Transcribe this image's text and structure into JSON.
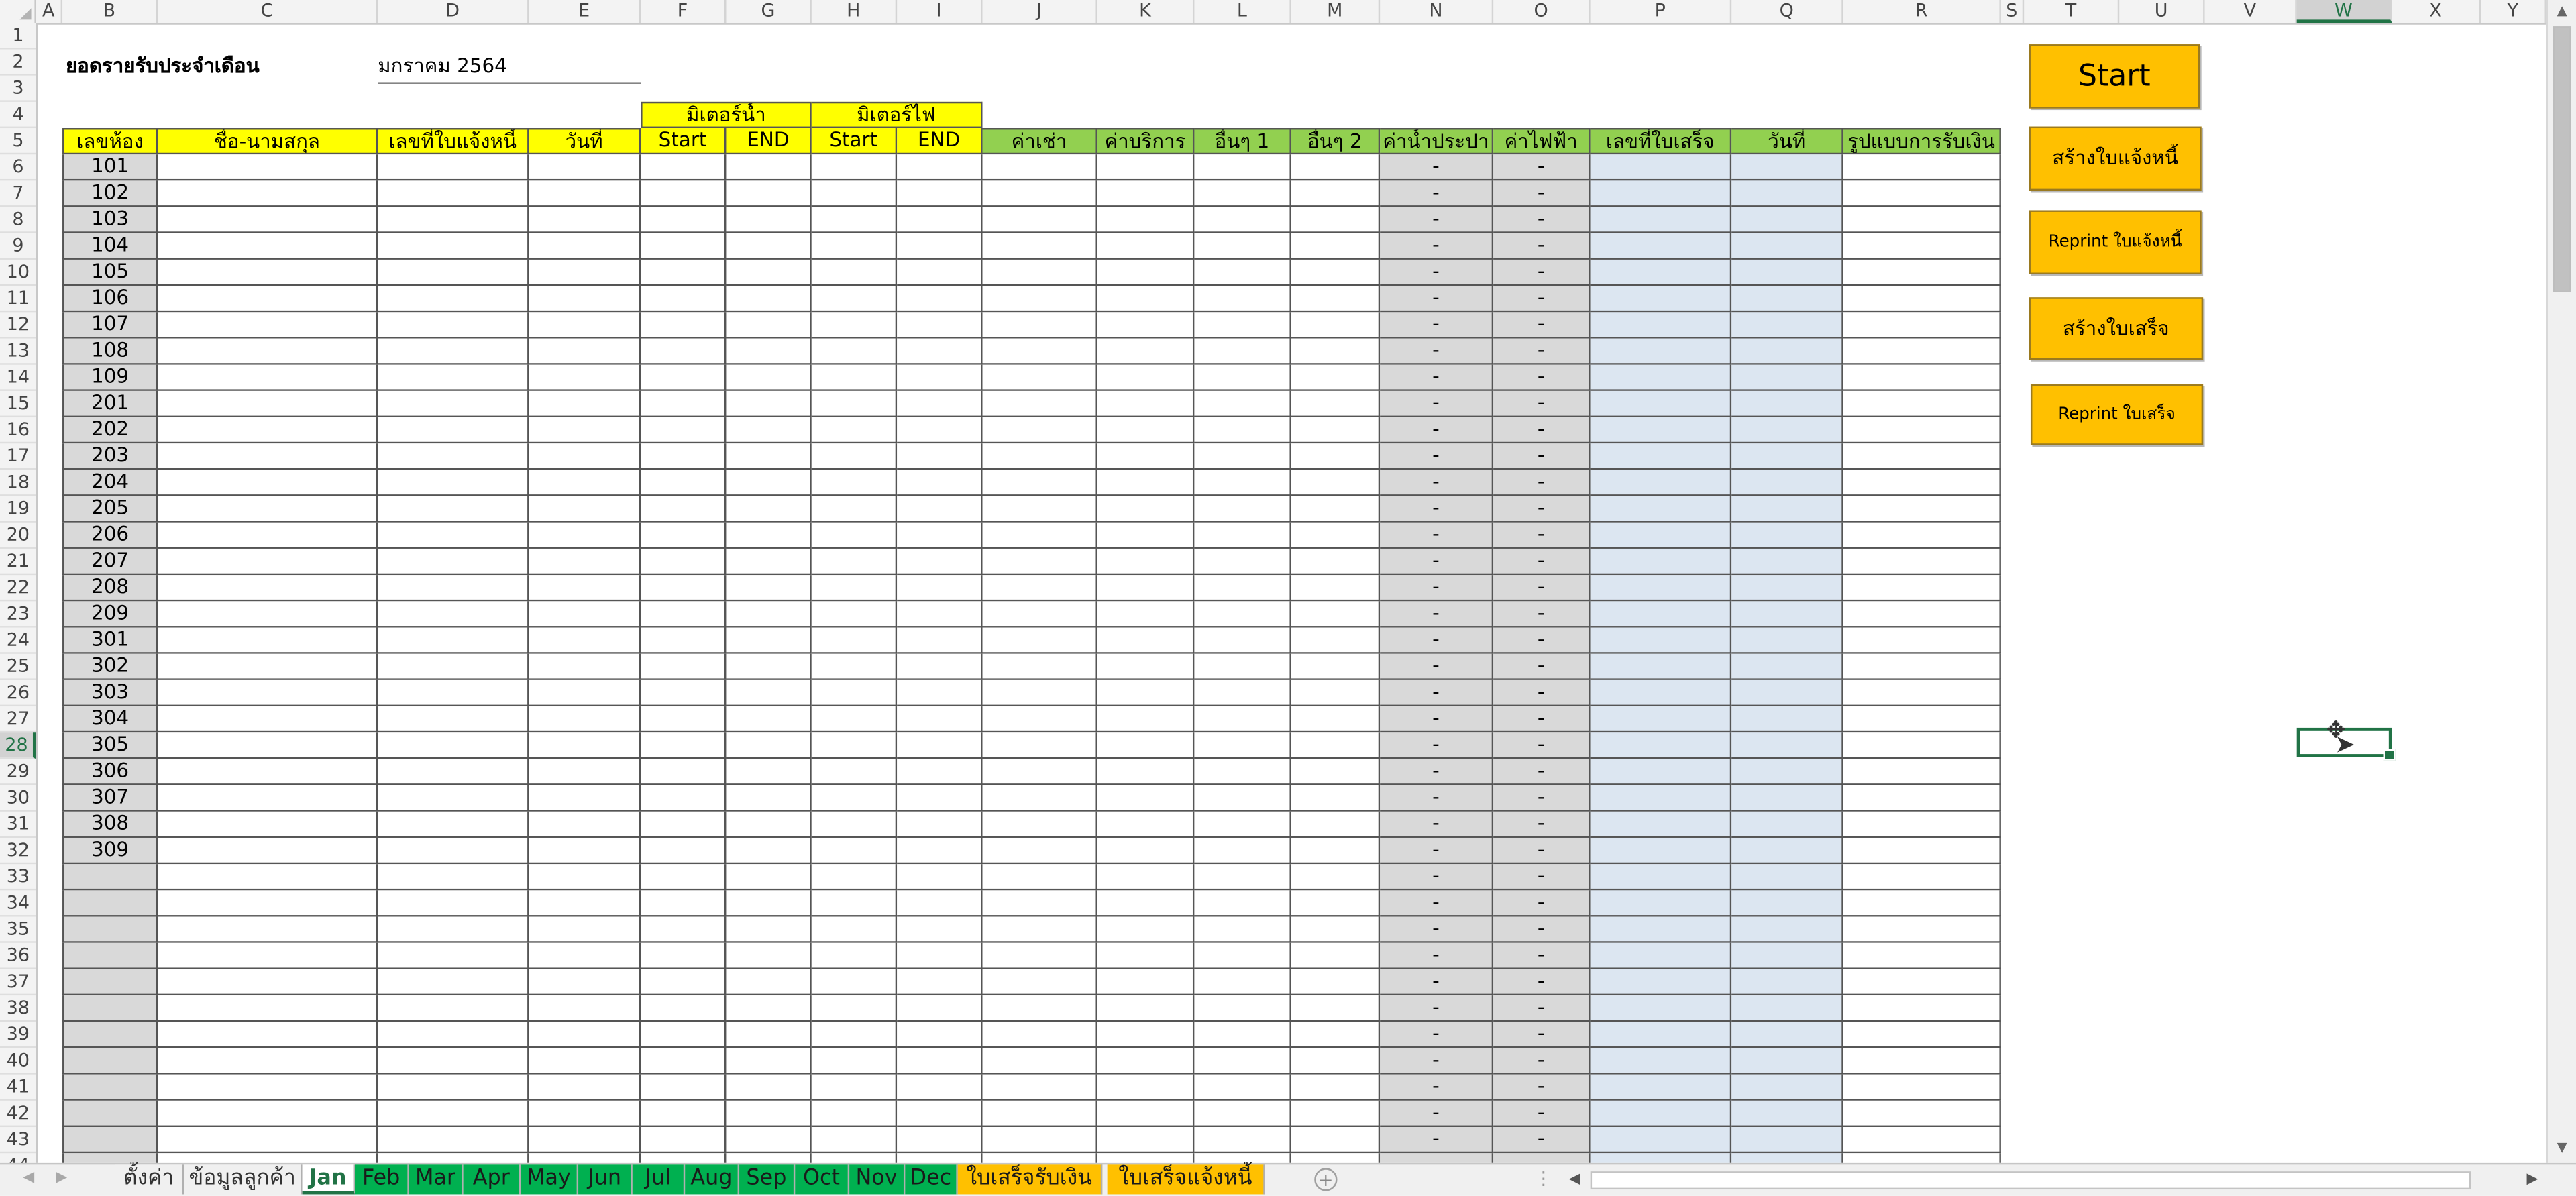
{
  "columns": [
    "A",
    "B",
    "C",
    "D",
    "E",
    "F",
    "G",
    "H",
    "I",
    "J",
    "K",
    "L",
    "M",
    "N",
    "O",
    "P",
    "Q",
    "R",
    "S",
    "T",
    "U",
    "V",
    "W",
    "X",
    "Y"
  ],
  "selected_column": "W",
  "selected_row": 28,
  "title": "ยอดรายรับประจำเดือน",
  "month": "มกราคม 2564",
  "group_headers": {
    "water_meter": "มิเตอร์น้ำ",
    "electric_meter": "มิเตอร์ไฟ"
  },
  "headers": {
    "room": "เลขห้อง",
    "name": "ชื่อ-นามสกุล",
    "invoice_no": "เลขที่ใบแจ้งหนี้",
    "date": "วันที่",
    "water_start": "Start",
    "water_end": "END",
    "elec_start": "Start",
    "elec_end": "END",
    "rent": "ค่าเช่า",
    "service": "ค่าบริการ",
    "other1": "อื่นๆ 1",
    "other2": "อื่นๆ 2",
    "water_fee": "ค่าน้ำประปา",
    "elec_fee": "ค่าไฟฟ้า",
    "receipt_no": "เลขที่ใบเสร็จ",
    "receipt_date": "วันที่",
    "payment_type": "รูปแบบการรับเงิน"
  },
  "rooms": [
    "101",
    "102",
    "103",
    "104",
    "105",
    "106",
    "107",
    "108",
    "109",
    "201",
    "202",
    "203",
    "204",
    "205",
    "206",
    "207",
    "208",
    "209",
    "301",
    "302",
    "303",
    "304",
    "305",
    "306",
    "307",
    "308",
    "309"
  ],
  "dash": "-",
  "buttons": {
    "start": "Start",
    "create_invoice": "สร้างใบแจ้งหนี้",
    "reprint_invoice": "Reprint ใบแจ้งหนี้",
    "create_receipt": "สร้างใบเสร็จ",
    "reprint_receipt": "Reprint ใบเสร็จ"
  },
  "tabs": [
    {
      "label": "ตั้งค่า",
      "style": "grey"
    },
    {
      "label": "ข้อมูลลูกค้า",
      "style": "grey"
    },
    {
      "label": "Jan",
      "style": "active"
    },
    {
      "label": "Feb",
      "style": "green"
    },
    {
      "label": "Mar",
      "style": "green"
    },
    {
      "label": "Apr",
      "style": "green"
    },
    {
      "label": "May",
      "style": "green"
    },
    {
      "label": "Jun",
      "style": "green"
    },
    {
      "label": "Jul",
      "style": "green"
    },
    {
      "label": "Aug",
      "style": "green"
    },
    {
      "label": "Sep",
      "style": "green"
    },
    {
      "label": "Oct",
      "style": "green"
    },
    {
      "label": "Nov",
      "style": "green"
    },
    {
      "label": "Dec",
      "style": "green"
    },
    {
      "label": "ใบเสร็จรับเงิน",
      "style": "orange"
    },
    {
      "label": "ใบเสร็จแจ้งหนี้",
      "style": "orange"
    }
  ],
  "colors": {
    "header_yellow": "#ffff00",
    "header_green": "#92d050",
    "calc_grey": "#d9d9d9",
    "receipt_blue": "#dce6f1",
    "button_orange": "#ffc000",
    "tab_green": "#00b050",
    "excel_green": "#217346"
  }
}
